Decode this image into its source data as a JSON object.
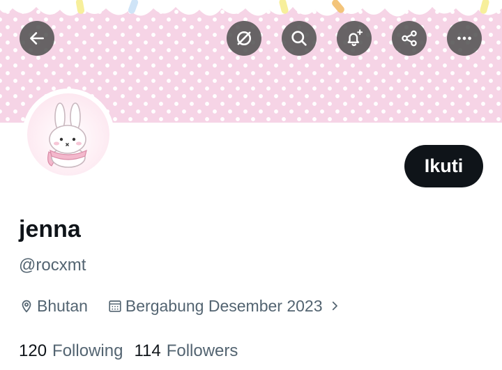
{
  "header": {
    "buttons": [
      {
        "name": "back-arrow-icon"
      },
      {
        "name": "grok-icon"
      },
      {
        "name": "search-icon"
      },
      {
        "name": "bell-plus-icon"
      },
      {
        "name": "share-icon"
      },
      {
        "name": "more-icon"
      }
    ],
    "banner_colors": {
      "base": "#f6d4e6",
      "dots": "#ffffff"
    }
  },
  "profile": {
    "avatar": "bunny-avatar",
    "follow_label": "Ikuti",
    "display_name": "jenna",
    "handle": "@rocxmt",
    "location": "Bhutan",
    "joined": "Bergabung Desember 2023",
    "following_count": "120",
    "following_label": "Following",
    "followers_count": "114",
    "followers_label": "Followers"
  },
  "colors": {
    "text": "#0f1419",
    "secondary": "#536471",
    "button": "#0f1419"
  }
}
